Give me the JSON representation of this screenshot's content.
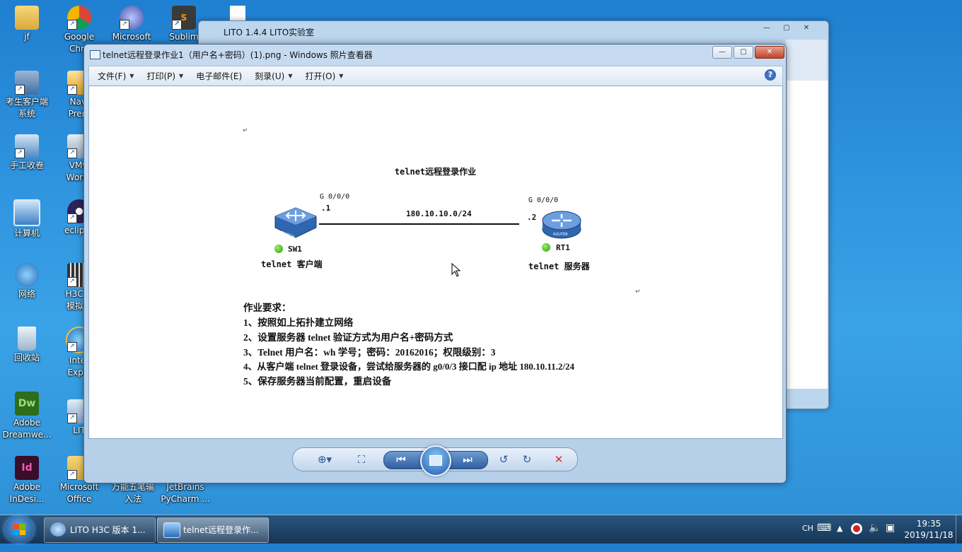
{
  "desktop": {
    "icons_col1": [
      {
        "label": "jf"
      },
      {
        "label": "考生客户端\n系统"
      },
      {
        "label": "手工收卷"
      },
      {
        "label": "计算机"
      },
      {
        "label": "网络"
      },
      {
        "label": "回收站"
      },
      {
        "label": "Adobe\nDreamwe..."
      },
      {
        "label": "Adobe\nInDesi..."
      }
    ],
    "icons_col2": [
      {
        "label": "Google\nChro"
      },
      {
        "label": "Navi\nPrem"
      },
      {
        "label": "VMw\nWorks"
      },
      {
        "label": "eclipse"
      },
      {
        "label": "H3C+I\n模拟器"
      },
      {
        "label": "Inter\nExplo"
      },
      {
        "label": "LIT"
      },
      {
        "label": "Microsoft\nOffice"
      }
    ],
    "icons_top": [
      {
        "label": "Microsoft"
      },
      {
        "label": "Sublim"
      }
    ],
    "icons_bottom": [
      {
        "label": "万能五笔输\n入法"
      },
      {
        "label": "JetBrains\nPyCharm ..."
      }
    ]
  },
  "lito_window": {
    "title": "LITO 1.4.4  LITO实验室"
  },
  "viewer": {
    "title": "telnet远程登录作业1（用户名+密码）(1).png - Windows 照片查看器",
    "menu": [
      "文件(F)",
      "打印(P)",
      "电子邮件(E)",
      "刻录(U)",
      "打开(O)"
    ],
    "help": "?"
  },
  "document": {
    "title": "telnet远程登录作业",
    "sw_port": "G 0/0/0",
    "sw_ip": ".1",
    "rt_port": "G 0/0/0",
    "rt_ip": ".2",
    "network": "180.10.10.0/24",
    "sw_name": "SW1",
    "sw_role": "telnet 客户端",
    "rt_name": "RT1",
    "rt_role": "telnet 服务器",
    "switch_text": "SWITCH",
    "router_text": "ROUTER",
    "req_title": "作业要求：",
    "requirements": [
      "1、按照如上拓扑建立网络",
      "2、设置服务器 telnet 验证方式为用户名+密码方式",
      "3、Telnet 用户名：wh 学号；密码：20162016；权限级别：3",
      "4、从客户端 telnet 登录设备，尝试给服务器的 g0/0/3 接口配 ip 地址 180.10.11.2/24",
      "5、保存服务器当前配置，重启设备"
    ]
  },
  "taskbar": {
    "items": [
      {
        "label": "LITO H3C 版本 1..."
      },
      {
        "label": "telnet远程登录作..."
      }
    ],
    "ime": "CH",
    "time": "19:35",
    "date": "2019/11/18"
  },
  "colors": {
    "desktop": "#2f95df",
    "status_green": "#2c9a10",
    "close_red": "#c0422a",
    "delete_red": "#d63020"
  }
}
